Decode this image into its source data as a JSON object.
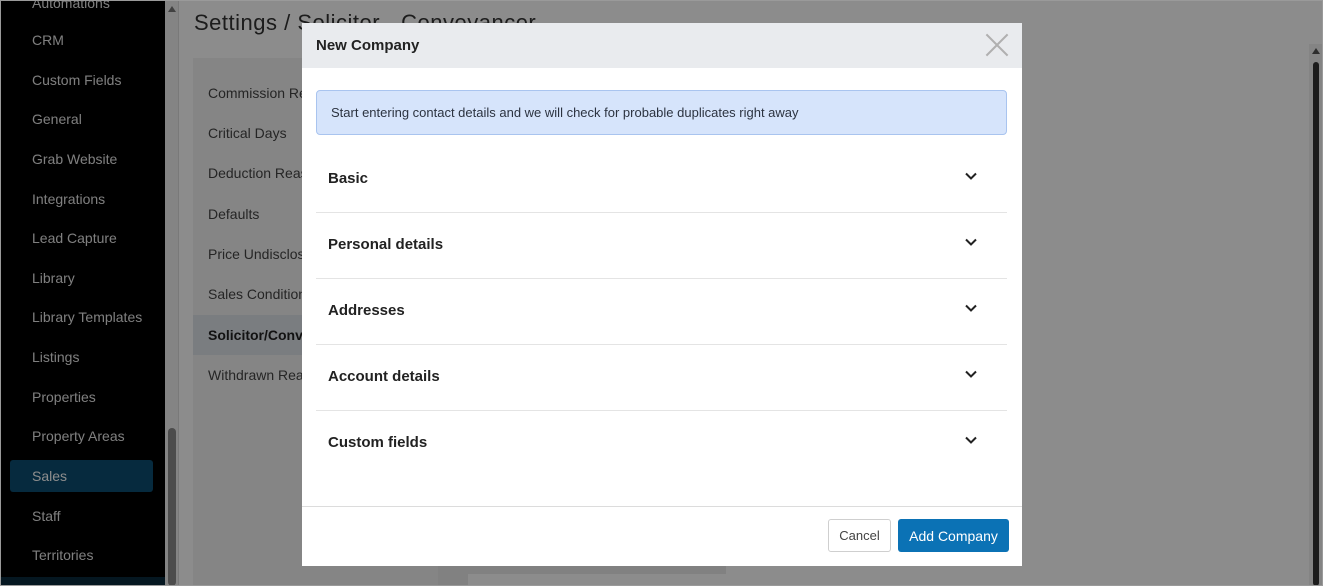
{
  "sidebar": {
    "items": [
      {
        "label": "Automations"
      },
      {
        "label": "CRM"
      },
      {
        "label": "Custom Fields"
      },
      {
        "label": "General"
      },
      {
        "label": "Grab Website"
      },
      {
        "label": "Integrations"
      },
      {
        "label": "Lead Capture"
      },
      {
        "label": "Library"
      },
      {
        "label": "Library Templates"
      },
      {
        "label": "Listings"
      },
      {
        "label": "Properties"
      },
      {
        "label": "Property Areas"
      },
      {
        "label": "Sales"
      },
      {
        "label": "Staff"
      },
      {
        "label": "Territories"
      }
    ],
    "active_item": "Sales"
  },
  "page": {
    "title": "Settings / Solicitor - Conveyancer"
  },
  "settings_nav": {
    "items": [
      {
        "label": "Commission Reasons"
      },
      {
        "label": "Critical Days"
      },
      {
        "label": "Deduction Reasons"
      },
      {
        "label": "Defaults"
      },
      {
        "label": "Price Undisclosed"
      },
      {
        "label": "Sales Conditions"
      },
      {
        "label": "Solicitor/Conveyancer"
      },
      {
        "label": "Withdrawn Reasons"
      }
    ],
    "active_item": "Solicitor/Conveyancer"
  },
  "modal": {
    "title": "New Company",
    "info_message": "Start entering contact details and we will check for probable duplicates right away",
    "sections": [
      {
        "label": "Basic"
      },
      {
        "label": "Personal details"
      },
      {
        "label": "Addresses"
      },
      {
        "label": "Account details"
      },
      {
        "label": "Custom fields"
      }
    ],
    "cancel_label": "Cancel",
    "submit_label": "Add Company"
  },
  "colors": {
    "sidebar_bg": "#000000",
    "sidebar_active": "#0c4e72",
    "primary_button": "#0b72b5",
    "info_bg": "#d6e4fb",
    "info_border": "#a9c4ef"
  },
  "icons": {
    "close": "close-icon",
    "section_toggle": "chevron-down-icon"
  }
}
